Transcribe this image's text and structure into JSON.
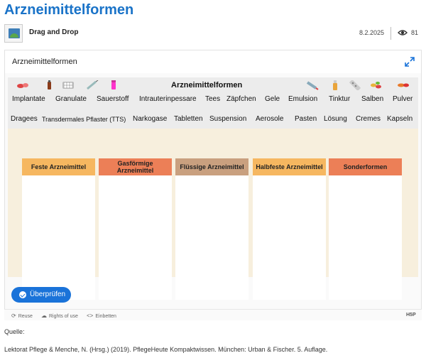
{
  "page": {
    "title": "Arzneimittelformen"
  },
  "meta": {
    "content_type": "Drag and Drop",
    "date": "8.2.2025",
    "views": "81"
  },
  "h5p": {
    "title": "Arzneimittelformen",
    "task_heading": "Arzneimittelformen",
    "row1": [
      "Implantate",
      "Granulate",
      "Sauerstoff",
      "Intrauterinpessare",
      "Tees",
      "Zäpfchen",
      "Gele",
      "Emulsion",
      "Tinktur",
      "Salben",
      "Pulver"
    ],
    "row2": [
      "Dragees",
      "Transdermales Pflaster (TTS)",
      "Narkogase",
      "Tabletten",
      "Suspension",
      "Aerosole",
      "Pasten",
      "Lösung",
      "Cremes",
      "Kapseln"
    ],
    "zones": [
      {
        "label": "Feste Arzneimittel",
        "color": "#f6b760"
      },
      {
        "label": "Gasförmige Arzneimittel",
        "color": "#ec7f57"
      },
      {
        "label": "Flüssige Arzneimittel",
        "color": "#c9a07f"
      },
      {
        "label": "Halbfeste Arzneimittel",
        "color": "#f6b760"
      },
      {
        "label": "Sonderformen",
        "color": "#ec7f57"
      }
    ],
    "check_button": "Überprüfen",
    "footer": {
      "reuse": "Reuse",
      "rights": "Rights of use",
      "embed": "Einbetten",
      "logo": "H5P"
    }
  },
  "source": {
    "label": "Quelle:",
    "text": "Lektorat Pflege & Menche, N. (Hrsg.) (2019). PflegeHeute Kompaktwissen. München: Urban & Fischer. 5. Auflage."
  },
  "colors": {
    "accent": "#1a73c8",
    "button": "#1a73d9",
    "task_bg": "#f7efdd"
  }
}
